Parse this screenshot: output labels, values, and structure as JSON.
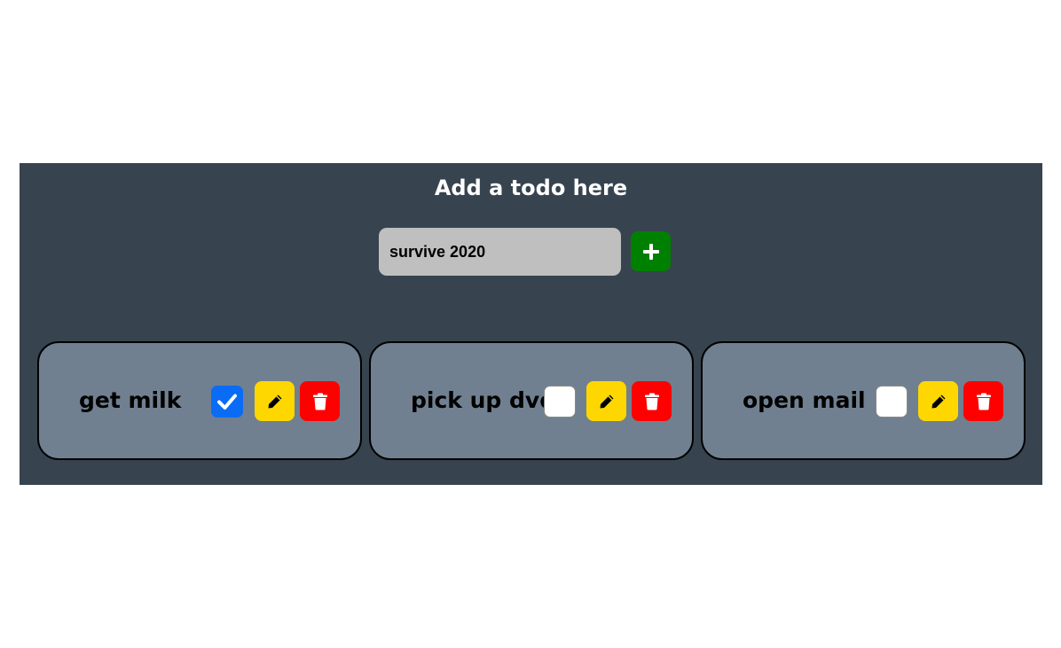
{
  "heading": "Add a todo here",
  "input": {
    "value": "survive 2020"
  },
  "add_button": {
    "icon": "plus-icon",
    "color": "#008000"
  },
  "colors": {
    "panel": "#37444f",
    "card": "#708090",
    "input": "#bfbfbf",
    "edit": "#ffd700",
    "delete": "#ff0000",
    "checked": "#0a6cf5"
  },
  "todos": [
    {
      "title": "get milk",
      "done": true,
      "edit_icon": "pencil-icon",
      "delete_icon": "trash-icon"
    },
    {
      "title": "pick up dvd",
      "done": false,
      "edit_icon": "pencil-icon",
      "delete_icon": "trash-icon"
    },
    {
      "title": "open mail",
      "done": false,
      "edit_icon": "pencil-icon",
      "delete_icon": "trash-icon"
    }
  ]
}
